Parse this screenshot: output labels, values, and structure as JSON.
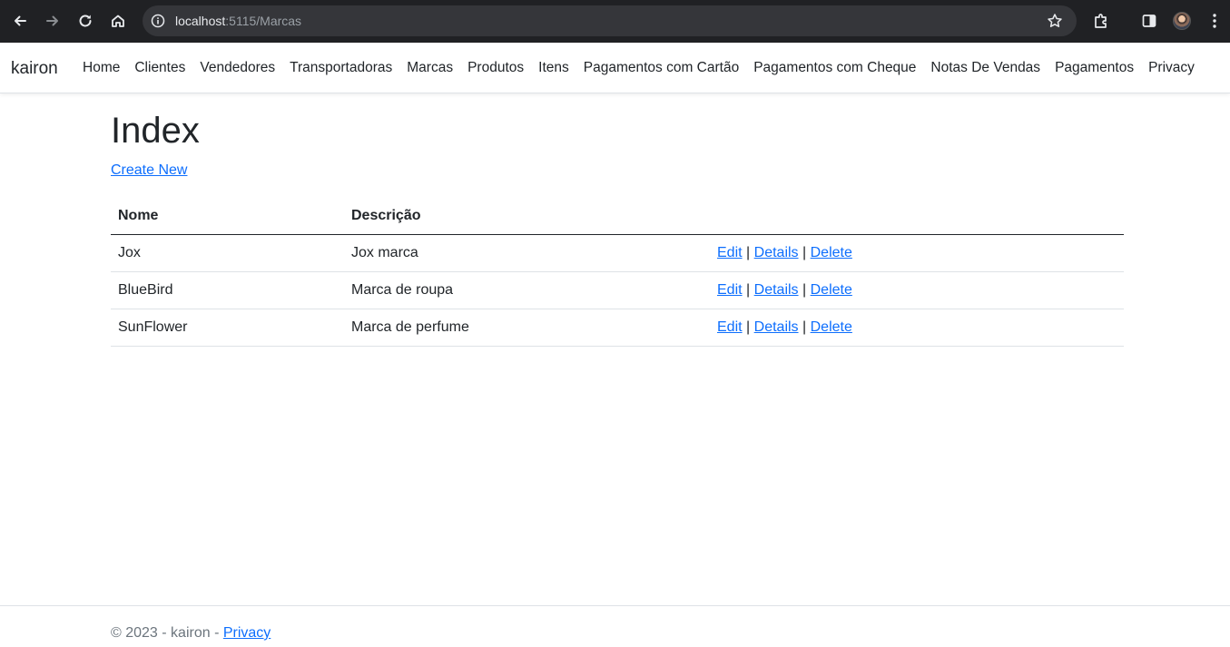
{
  "browser": {
    "url_host": "localhost",
    "url_path": ":5115/Marcas",
    "icons": [
      "back-icon",
      "forward-icon",
      "reload-icon",
      "home-icon",
      "site-info-icon",
      "bookmark-star-icon",
      "extensions-icon",
      "side-panel-icon",
      "profile-avatar",
      "menu-icon"
    ]
  },
  "navbar": {
    "brand": "kairon",
    "links": [
      "Home",
      "Clientes",
      "Vendedores",
      "Transportadoras",
      "Marcas",
      "Produtos",
      "Itens",
      "Pagamentos com Cartão",
      "Pagamentos com Cheque",
      "Notas De Vendas",
      "Pagamentos",
      "Privacy"
    ]
  },
  "main": {
    "title": "Index",
    "create_new": "Create New",
    "table": {
      "headers": [
        "Nome",
        "Descrição"
      ],
      "rows": [
        {
          "nome": "Jox",
          "descricao": "Jox marca"
        },
        {
          "nome": "BlueBird",
          "descricao": "Marca de roupa"
        },
        {
          "nome": "SunFlower",
          "descricao": "Marca de perfume"
        }
      ],
      "actions": {
        "edit": "Edit",
        "details": "Details",
        "delete": "Delete",
        "separator": "|"
      }
    }
  },
  "footer": {
    "copyright": "© 2023 - kairon - ",
    "privacy": "Privacy"
  },
  "colors": {
    "chrome_bg": "#202124",
    "omnibox_bg": "#35363a",
    "link": "#0d6efd",
    "text": "#212529",
    "muted": "#6c757d"
  }
}
